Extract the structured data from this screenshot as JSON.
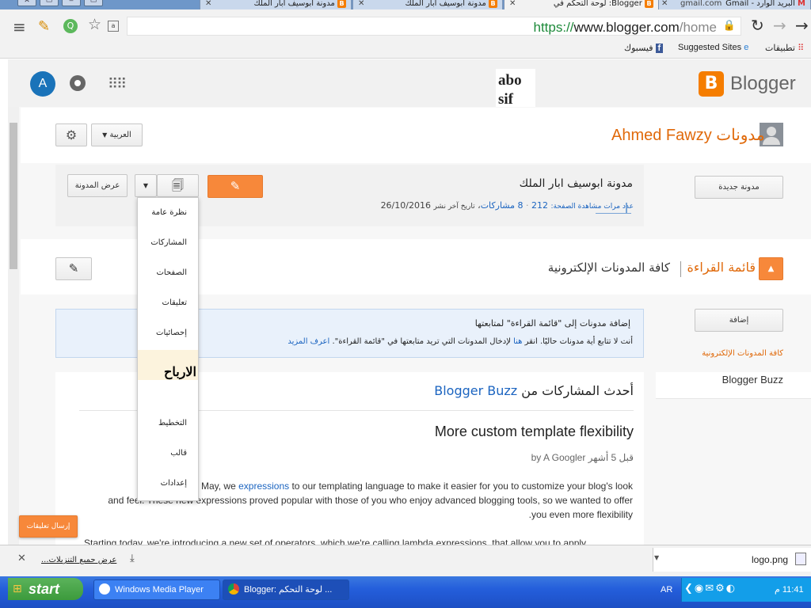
{
  "browser": {
    "tabs": [
      {
        "title": "البريد الوارد - Gmail",
        "suffix": "gmail.com",
        "active": false
      },
      {
        "title": "Blogger: لوحة التحكم في",
        "suffix": "Blo",
        "active": true
      },
      {
        "title": "مدونة ابوسيف ابار الملك",
        "suffix": "",
        "active": false
      },
      {
        "title": "مدونة ابوسيف ابار الملك",
        "suffix": "",
        "active": false
      }
    ],
    "url_scheme": "https://",
    "url_host": "www.blogger.com",
    "url_path": "/home",
    "bookmarks": {
      "apps": "تطبيقات",
      "suggested": "Suggested Sites",
      "facebook": "فيسبوك"
    }
  },
  "blogger_header": {
    "avatar_letter": "A",
    "logo_text": "Blogger",
    "overlay_text_line1": "abo",
    "overlay_text_line2": "sif"
  },
  "blogs_section": {
    "owner_name": "Ahmed Fawzy",
    "title_label": "مدونات",
    "language": "العربية",
    "new_blog_button": "مدونة جديدة",
    "view_blog_button": "عرض المدونة",
    "blog_title": "مدونة ابوسيف ابار الملك",
    "stats_label": "عدد مرات مشاهدة الصفحة:",
    "pageviews": "212",
    "posts": "8 مشاركات",
    "last_published_label": "تاريخ آخر نشر",
    "last_published_date": "26/10/2016"
  },
  "dropdown_menu": {
    "items": [
      "نظرة عامة",
      "المشاركات",
      "الصفحات",
      "تعليقات",
      "إحصائيات",
      "",
      "",
      "التخطيط",
      "قالب",
      "إعدادات"
    ],
    "overlay_text": "الارباح"
  },
  "reading_list": {
    "title": "قائمة القراءة",
    "subtitle": "كافة المدونات الإلكترونية",
    "add_button": "إضافة",
    "side_link_all": "كافة المدونات الإلكترونية",
    "side_link_buzz": "Blogger Buzz",
    "info_title": "إضافة مدونات إلى \"قائمة القراءة\" لمتابعتها",
    "info_body_1": "أنت لا تتابع أية مدونات حاليًا. انقر",
    "info_link_here": "هنا",
    "info_body_2": "لإدخال المدونات التي تريد متابعتها في \"قائمة القراءة\".",
    "info_learn_more": "اعرف المزيد"
  },
  "buzz": {
    "heading_prefix": "أحدث المشاركات من",
    "heading_link": "Blogger Buzz",
    "post_title": "More custom template flexibility",
    "byline": "by A Googler قبل 5 أشهر",
    "para1_pre": "Last May, we",
    "para1_link": "expressions",
    "para1_post": "to our templating language to make it easier for you to customize your blog's look",
    "para1_line2": "and feel. These new expressions proved popular with those of you who enjoy advanced blogging tools, so we wanted to offer",
    "para1_line3": ".you even more flexibility",
    "para2": "Starting today, we're introducing a new set of operators, which we're calling lambda expressions, that allow you to apply"
  },
  "feedback_button": "إرسال تعليقات",
  "downloads": {
    "file": "logo.png",
    "show_all": "عرض جميع التنزيلات..."
  },
  "taskbar": {
    "start": "start",
    "items": [
      "Windows Media Player",
      "Blogger: لوحة التحكم ..."
    ],
    "lang": "AR",
    "time": "11:41 م"
  },
  "colors": {
    "blogger_orange": "#f57d00",
    "link_blue": "#1b64c0",
    "taskbar_blue": "#245edb"
  }
}
